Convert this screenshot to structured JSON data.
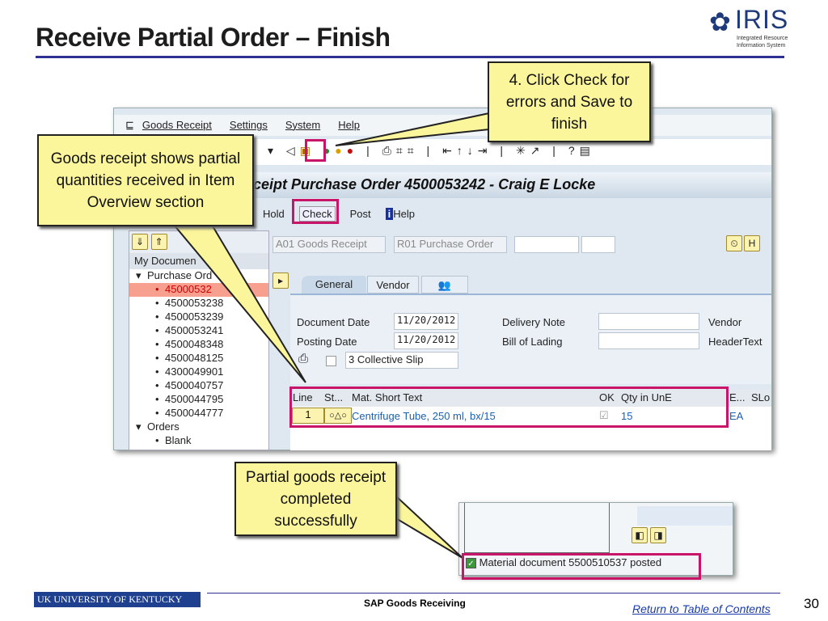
{
  "slide": {
    "title": "Receive Partial Order – Finish",
    "page_number": "30",
    "footer_center": "SAP Goods Receiving",
    "footer_link": "Return to Table of Contents",
    "logo_text": "IRIS",
    "logo_sub1": "Integrated Resource",
    "logo_sub2": "Information System",
    "uk_logo": "UK UNIVERSITY OF KENTUCKY"
  },
  "callouts": {
    "left": "Goods receipt shows partial quantities received in Item Overview section",
    "top": "4. Click Check for errors and Save to finish",
    "bottom": "Partial goods receipt completed successfully"
  },
  "sap": {
    "menu": [
      "Goods Receipt",
      "Settings",
      "System",
      "Help"
    ],
    "window_title": "Goods Receipt Purchase Order 4500053242 - Craig E Locke",
    "window_title_visible": "ceipt Purchase Order 4500053242 - Craig E Locke",
    "app_toolbar": {
      "hold": "Hold",
      "check": "Check",
      "post": "Post",
      "help": "Help"
    },
    "action": "A01 Goods Receipt",
    "ref_doc": "R01 Purchase Order",
    "tree": {
      "header": "My Documen",
      "purchase_orders": "Purchase Ord",
      "po_items": [
        "45000532",
        "4500053238",
        "4500053239",
        "4500053241",
        "4500048348",
        "4500048125",
        "4300049901",
        "4500040757",
        "4500044795",
        "4500044777"
      ],
      "orders": "Orders",
      "blank": "Blank"
    },
    "tabs": [
      "General",
      "Vendor"
    ],
    "header_fields": {
      "document_date_label": "Document Date",
      "document_date": "11/20/2012",
      "posting_date_label": "Posting Date",
      "posting_date": "11/20/2012",
      "delivery_note_label": "Delivery Note",
      "bill_of_lading_label": "Bill of Lading",
      "vendor_label": "Vendor",
      "header_text_label": "HeaderText",
      "slip": "3 Collective Slip"
    },
    "items": {
      "columns": [
        "Line",
        "St...",
        "Mat. Short Text",
        "OK",
        "Qty in UnE",
        "E...",
        "SLo"
      ],
      "rows": [
        {
          "line": "1",
          "text": "Centrifuge Tube, 250 ml, bx/15",
          "qty": "15",
          "unit": "EA"
        }
      ]
    },
    "status_message": "Material document 5500510537 posted"
  },
  "colors": {
    "highlight": "#c8156a",
    "callout": "#fbf59b",
    "title_rule": "#2e3192"
  }
}
